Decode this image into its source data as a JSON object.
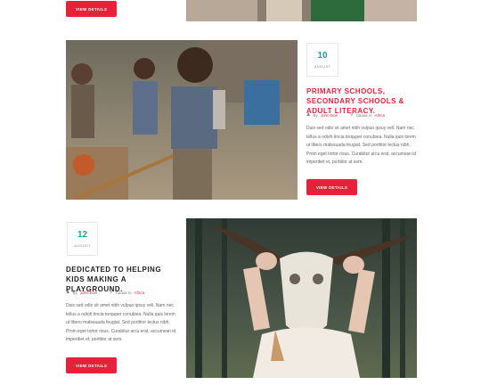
{
  "top": {
    "button_label": "VIEW DETAILS"
  },
  "posts": [
    {
      "day": "10",
      "month": "AUGUST",
      "title": "PRIMARY SCHOOLS, SECONDARY SCHOOLS & ADULT LITERACY.",
      "by_label": "By",
      "author": "John Doe",
      "cause_label": "Cause in",
      "cause": "Africa",
      "excerpt": "Duis sed odio sit amet nibh vulpuo ipsuy veli. Nam nec tellus a odioh tincia torquper conubiea. Nulla quis lorem ut libero malesuada feugiat. Sed porttitor lectus nibh. Proin eget tortor risus. Curabitur arcu erat, accumsan id imperdiet et, porttitor at sem.",
      "button_label": "VIEW DETAILS",
      "title_color": "#e8213a"
    },
    {
      "day": "12",
      "month": "AUGUST",
      "title": "DEDICATED TO HELPING KIDS MAKING A PLAYGROUND.",
      "by_label": "By",
      "author": "John Doe",
      "cause_label": "Cause in",
      "cause": "Africa",
      "excerpt": "Duis sed odio sit amet nibh vulpuo ipsuy veli. Nam nec tellus a odioh tincia torquper conubiea. Nulla quis lorem ut libero malesuada feugiat. Sed porttitor lectus nibh. Proin eget tortor risus. Curabitur arcu erat, accumsan id imperdiet et, porttitor at sem.",
      "button_label": "VIEW DETAILS",
      "title_color": "#222222"
    }
  ],
  "colors": {
    "accent": "#e8213a",
    "date": "#19a39a"
  }
}
